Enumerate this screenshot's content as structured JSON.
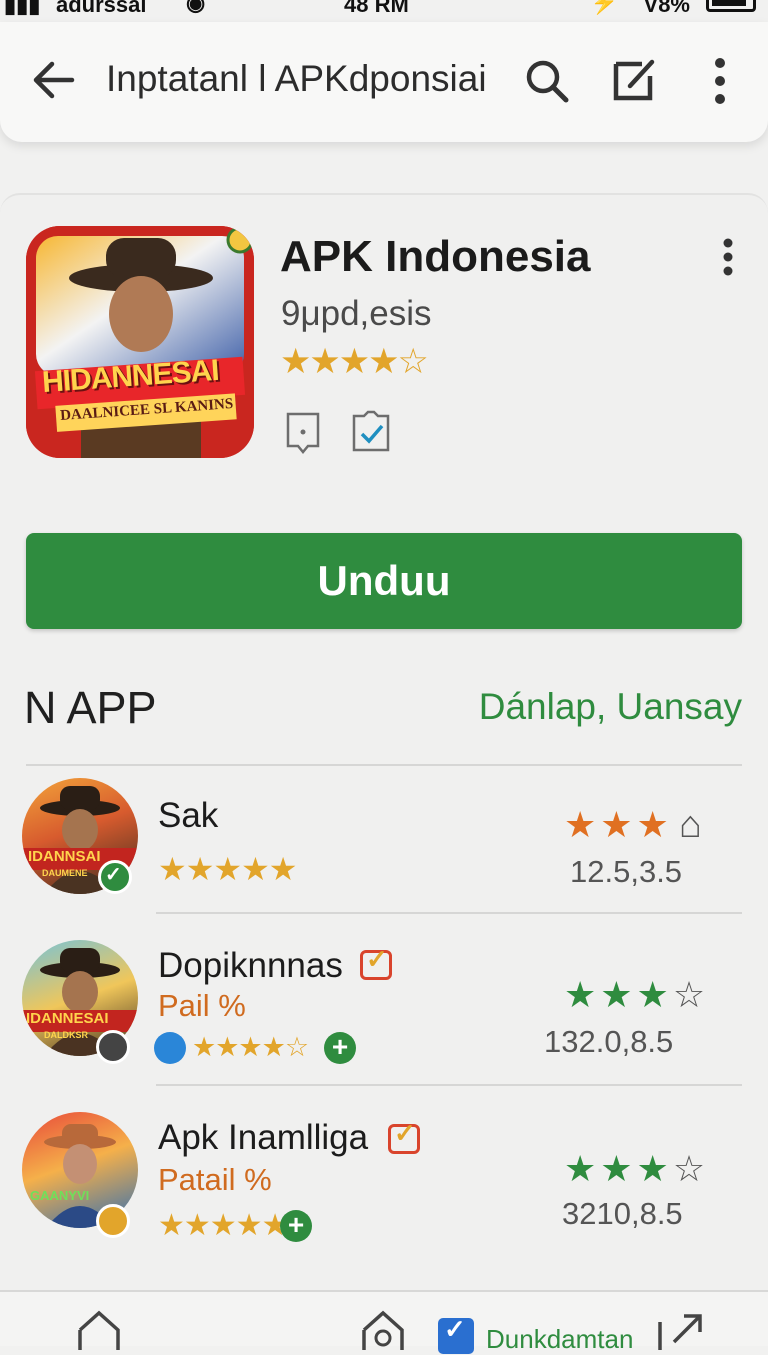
{
  "status": {
    "carrier": "adurssal",
    "time": "48 RM",
    "battery_text": "V8%"
  },
  "header": {
    "title": "Inptatanl l APKdponsiai"
  },
  "app": {
    "name": "APK Indonesia",
    "developer": "9μpd,esis",
    "rating_stars": 4,
    "icon_text_main": "HIDANNESAI",
    "icon_text_sub": "DAALNICEE SL KANINS"
  },
  "install_button": {
    "label": "Unduu"
  },
  "section": {
    "title": "N APP",
    "link": "Dánlap, Uansay"
  },
  "list": [
    {
      "name": "Sak",
      "subtitle": "",
      "value": "12.5,3.5",
      "left_stars": 5,
      "right_stars_filled": 3,
      "accent": "#e07022",
      "avatar_text": "IDANNSAI",
      "avatar_sub": "DAUMENE"
    },
    {
      "name": "Dopiknnnas",
      "subtitle": "Pail %",
      "value": "132.0,8.5",
      "left_stars": 4,
      "right_stars_filled": 3,
      "accent": "#2f8c3f",
      "avatar_text": "IDANNESAI",
      "avatar_sub": "DALDKSR"
    },
    {
      "name": "Apk Inamlliga",
      "subtitle": "Patail %",
      "value": "3210,8.5",
      "left_stars": 4,
      "right_stars_filled": 3,
      "accent": "#2f8c3f",
      "avatar_text": "GAANYVI",
      "avatar_sub": ""
    }
  ],
  "bottom_nav": {
    "label": "Dunkdamtan"
  },
  "colors": {
    "primary_green": "#2f8c3f",
    "star_gold": "#e2a52b",
    "star_orange": "#e07022"
  }
}
